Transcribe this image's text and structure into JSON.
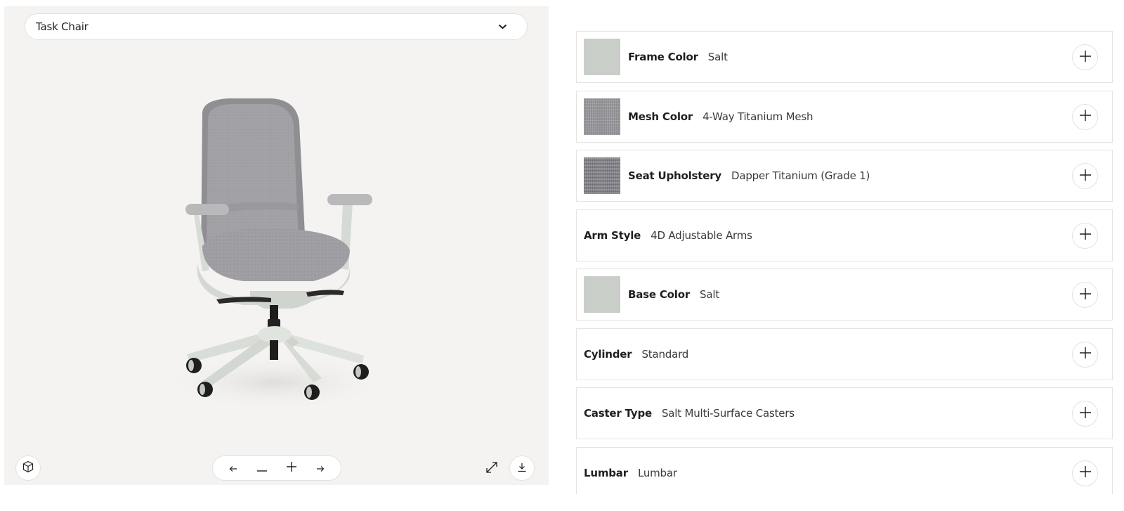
{
  "viewer": {
    "model_select": {
      "label": "Task Chair",
      "icon": "chevron-down-icon"
    },
    "controls": {
      "view_3d": {
        "icon": "cube-icon"
      },
      "rotate_left": {
        "icon": "arrow-left-icon"
      },
      "zoom_out": {
        "icon": "minus-icon"
      },
      "zoom_in": {
        "icon": "plus-icon"
      },
      "rotate_right": {
        "icon": "arrow-right-icon"
      },
      "fullscreen": {
        "icon": "expand-icon"
      },
      "download": {
        "icon": "download-icon"
      }
    },
    "image": {
      "subject": "office task chair with gray mesh back, gray seat, salt frame and 5-star base"
    }
  },
  "options": [
    {
      "name": "Frame Color",
      "value": "Salt",
      "swatch": "salt",
      "swatch_color": "#c9cec8",
      "action_icon": "plus-icon"
    },
    {
      "name": "Mesh Color",
      "value": "4-Way Titanium Mesh",
      "swatch": "mesh",
      "swatch_color": "#8e8d92",
      "action_icon": "plus-icon"
    },
    {
      "name": "Seat Upholstery",
      "value": "Dapper Titanium (Grade 1)",
      "swatch": "dapper",
      "swatch_color": "#7d7c82",
      "action_icon": "plus-icon"
    },
    {
      "name": "Arm Style",
      "value": "4D Adjustable Arms",
      "swatch": null,
      "action_icon": "plus-icon"
    },
    {
      "name": "Base Color",
      "value": "Salt",
      "swatch": "salt",
      "swatch_color": "#c9cec8",
      "action_icon": "plus-icon"
    },
    {
      "name": "Cylinder",
      "value": "Standard",
      "swatch": null,
      "action_icon": "plus-icon"
    },
    {
      "name": "Caster Type",
      "value": "Salt Multi-Surface Casters",
      "swatch": null,
      "action_icon": "plus-icon"
    },
    {
      "name": "Lumbar",
      "value": "Lumbar",
      "swatch": null,
      "action_icon": "plus-icon"
    }
  ],
  "colors": {
    "viewer_bg": "#f4f3f1",
    "border": "#e6e4e1",
    "text": "#1f1f1f"
  }
}
